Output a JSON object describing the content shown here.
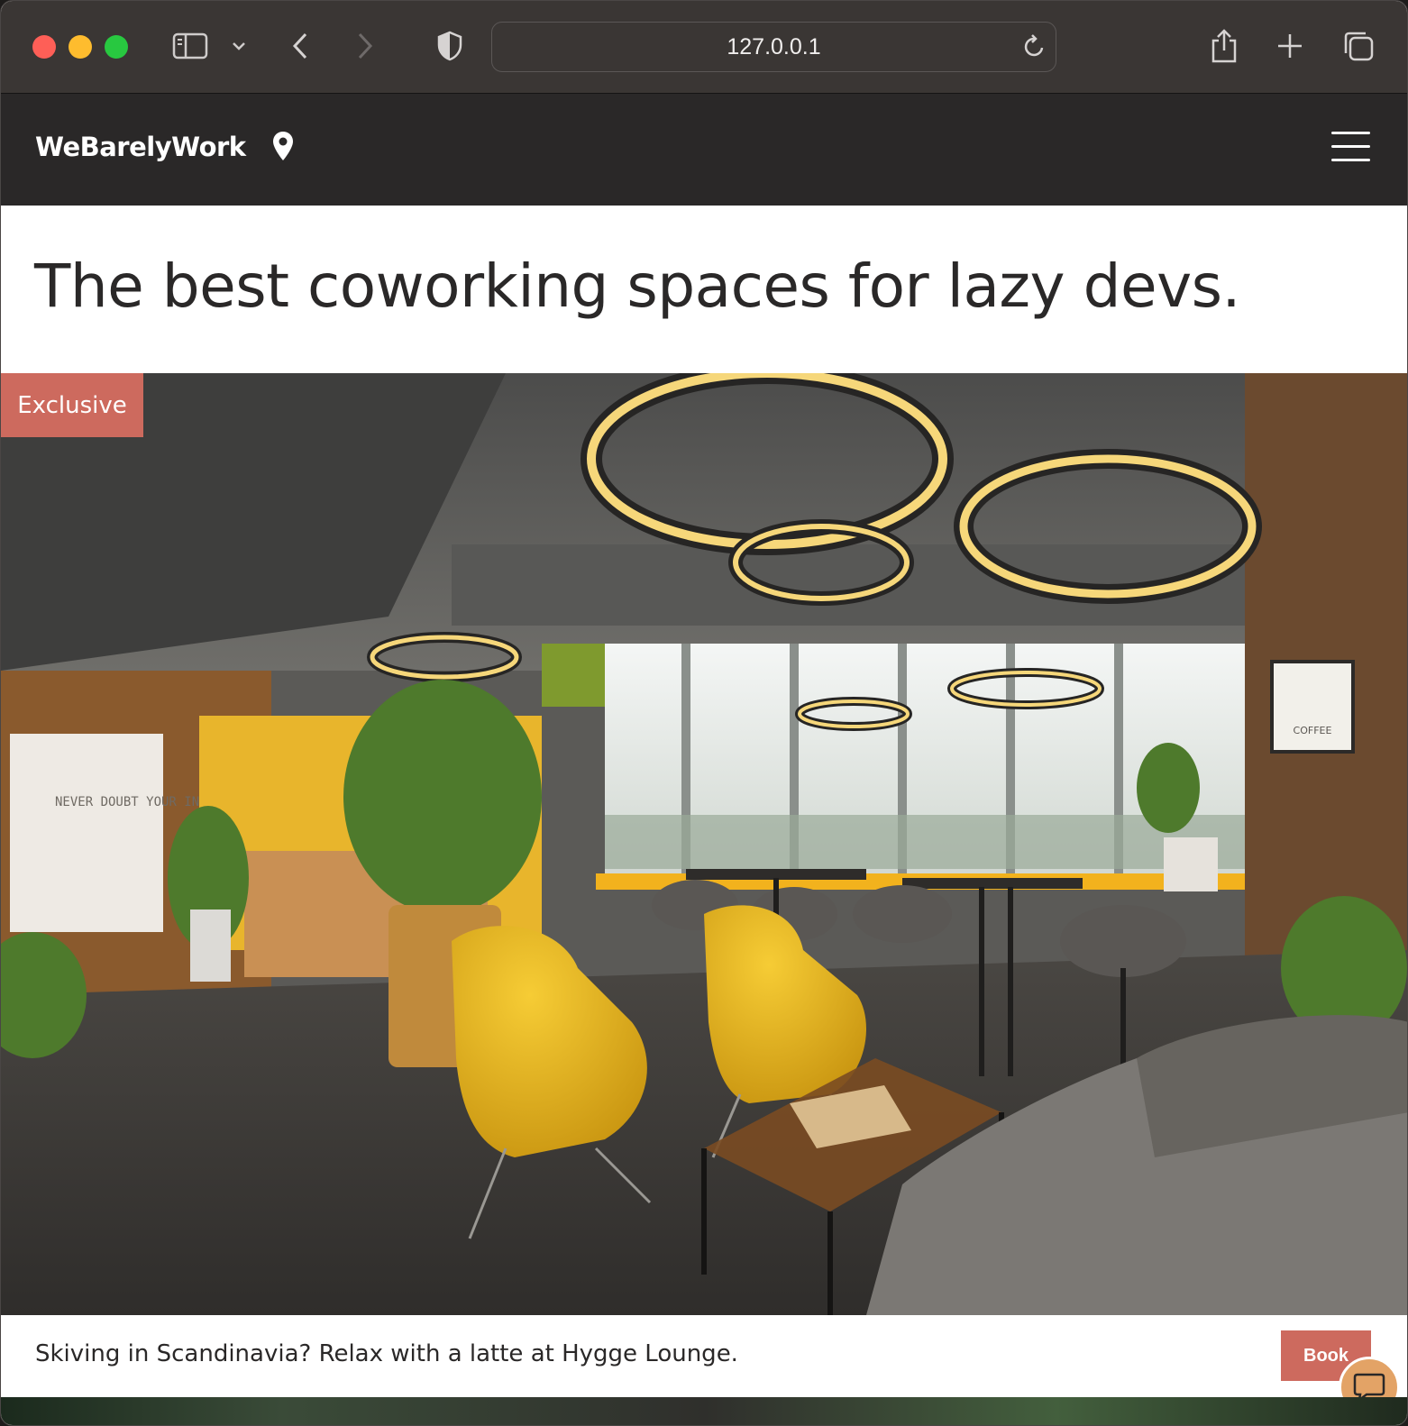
{
  "browser": {
    "url": "127.0.0.1",
    "colors": {
      "close": "#fe5f57",
      "minimize": "#febc2e",
      "zoom": "#28c840"
    }
  },
  "site": {
    "brand": "WeBarelyWork",
    "headline": "The best coworking spaces for lazy devs.",
    "accent_color": "#cd6a5e",
    "nav_color": "#2a2828"
  },
  "listing": {
    "badge": "Exclusive",
    "photo_wall_text": "NEVER DOUBT YOUR INSTINCT.",
    "photo_sign_text": "COFFEE",
    "caption": "Skiving in Scandinavia? Relax with a latte at Hygge Lounge.",
    "book_label": "Book"
  }
}
